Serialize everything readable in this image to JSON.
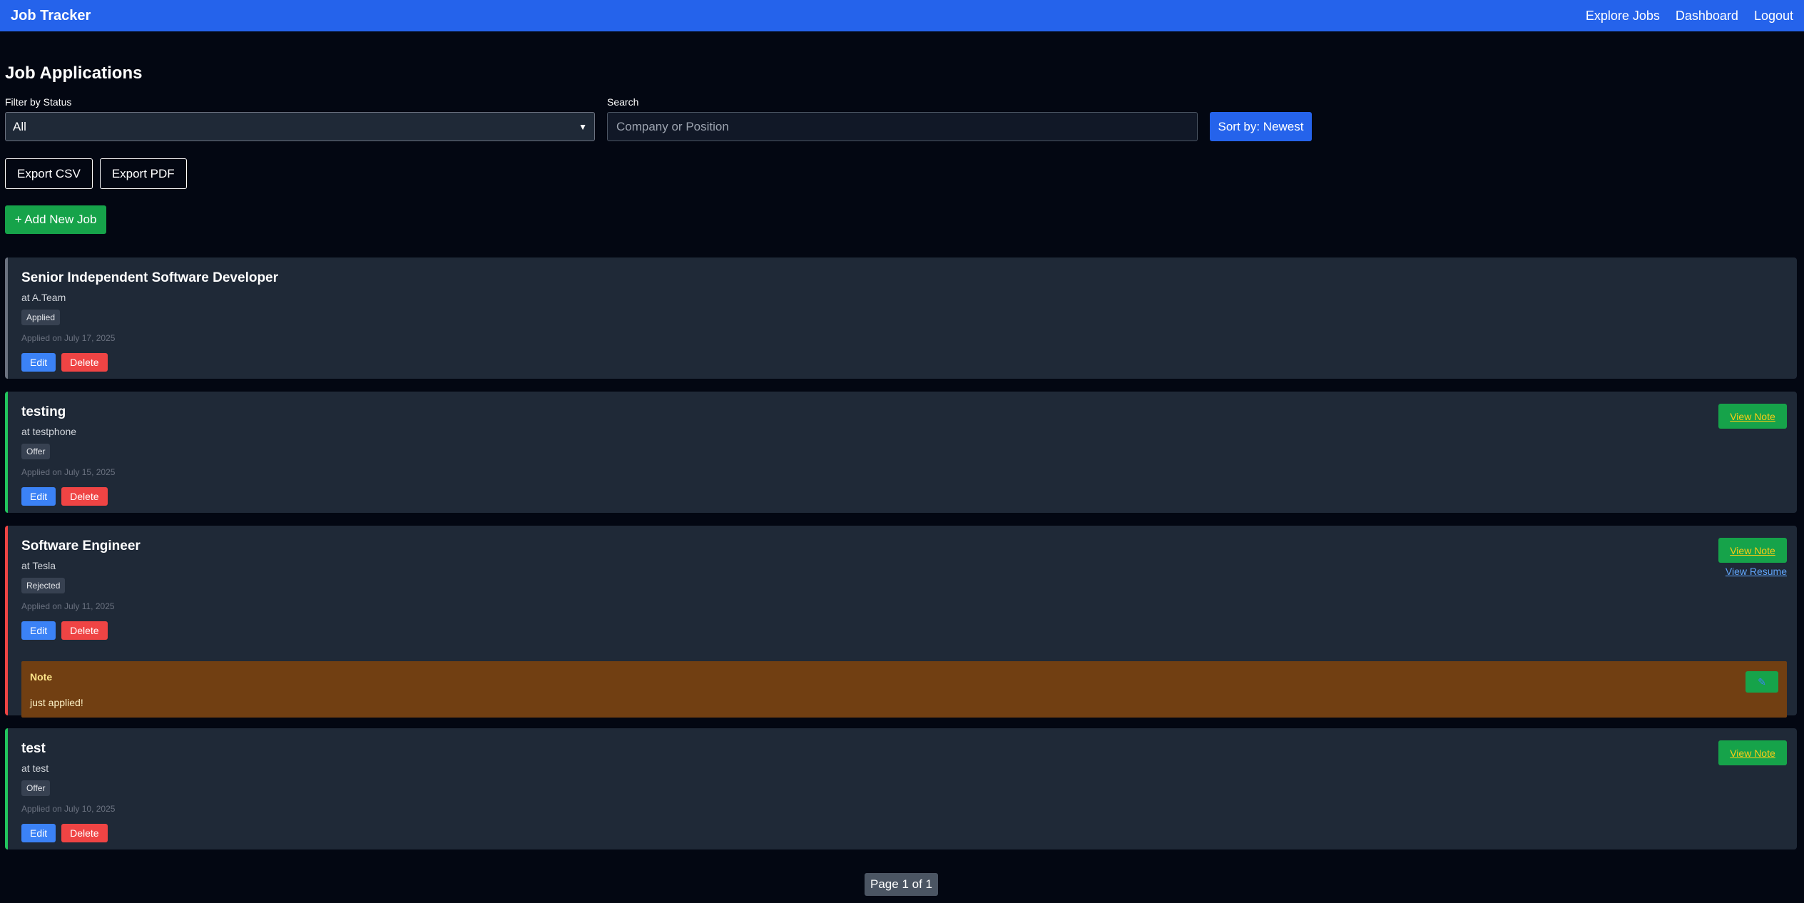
{
  "navbar": {
    "brand": "Job Tracker",
    "links": [
      "Explore Jobs",
      "Dashboard",
      "Logout"
    ]
  },
  "page": {
    "title": "Job Applications"
  },
  "filters": {
    "status_label": "Filter by Status",
    "status_value": "All",
    "search_label": "Search",
    "search_placeholder": "Company or Position",
    "sort_label": "Sort by: Newest"
  },
  "actions": {
    "export_csv": "Export CSV",
    "export_pdf": "Export PDF",
    "add_job": "+ Add New Job"
  },
  "jobs": [
    {
      "title": "Senior Independent Software Developer",
      "company": "at A.Team",
      "status": "Applied",
      "applied": "Applied on July 17, 2025",
      "edit": "Edit",
      "delete": "Delete"
    },
    {
      "title": "testing",
      "company": "at testphone",
      "status": "Offer",
      "applied": "Applied on July 15, 2025",
      "edit": "Edit",
      "delete": "Delete",
      "view_note": "View Note"
    },
    {
      "title": "Software Engineer",
      "company": "at Tesla",
      "status": "Rejected",
      "applied": "Applied on July 11, 2025",
      "edit": "Edit",
      "delete": "Delete",
      "view_note": "View Note",
      "view_resume": "View Resume",
      "note_title": "Note",
      "note_text": "just applied!"
    },
    {
      "title": "test",
      "company": "at test",
      "status": "Offer",
      "applied": "Applied on July 10, 2025",
      "edit": "Edit",
      "delete": "Delete",
      "view_note": "View Note"
    }
  ],
  "pagination": {
    "label": "Page 1 of 1"
  },
  "colors": {
    "navbar": "#2563eb",
    "background": "#030712",
    "card": "#1f2937",
    "applied_border": "#6b7280",
    "offer_border": "#22c55e",
    "rejected_border": "#ef4444",
    "note_bg": "#713f12"
  }
}
